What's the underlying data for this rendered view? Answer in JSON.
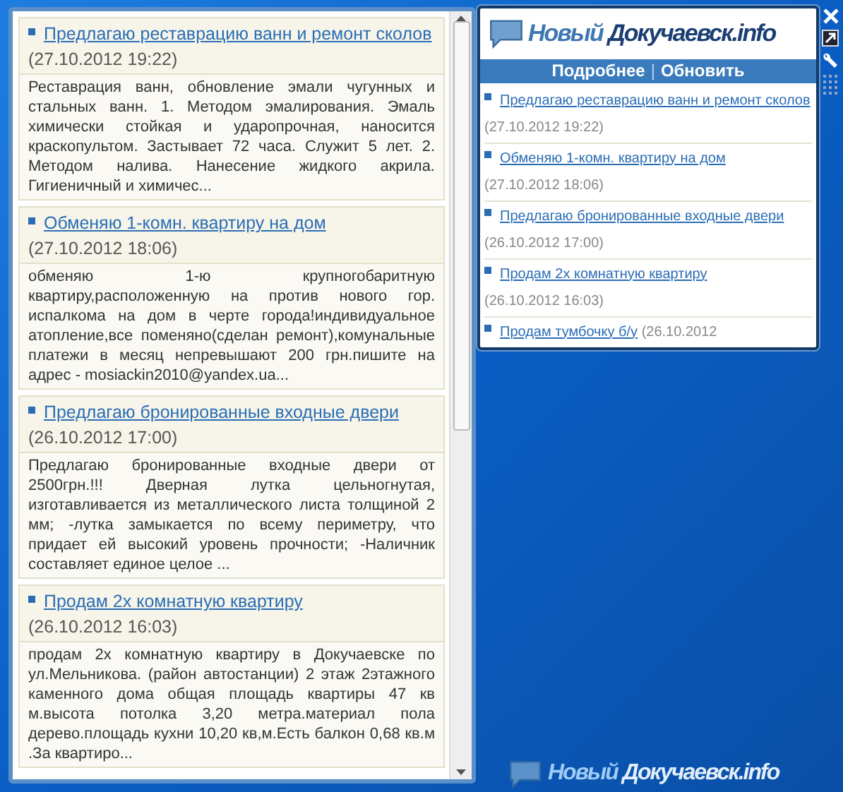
{
  "flyout": {
    "items": [
      {
        "title": "Предлагаю реставрацию ванн и ремонт сколов",
        "date": "(27.10.2012 19:22)",
        "body": "Реставрация ванн, обновление эмали чугунных и стальных ванн. 1. Методом эмалирования. Эмаль химически стойкая и ударопрочная, наносится краскопультом. Застывает 72 часа. Служит 5 лет. 2. Методом налива. Нанесение жидкого акрила. Гигиеничный и химичес..."
      },
      {
        "title": "Обменяю 1-комн. квартиру на дом",
        "date": "(27.10.2012 18:06)",
        "body": "обменяю 1-ю крупногобаритную квартиру,расположенную на против нового гор. испалкома на дом в черте города!индивидуальное атопление,все поменяно(сделан ремонт),комунальные платежи в месяц непревышают 200 грн.пишите на адрес - mosiackin2010@yandex.ua..."
      },
      {
        "title": "Предлагаю бронированные входные двери",
        "date": "(26.10.2012 17:00)",
        "body": "Предлагаю бронированные входные двери от 2500грн.!!! Дверная лутка цельногнутая, изготавливается из металлического листа толщиной 2 мм; -лутка замыкается по всему периметру, что придает ей высокий уровень прочности; -Наличник составляет единое целое ..."
      },
      {
        "title": "Продам 2х комнатную квартиру",
        "date": "(26.10.2012 16:03)",
        "body": "продам 2х комнатную квартиру в Докучаевске по ул.Мельникова. (район автостанции) 2 этаж 2этажного каменного дома общая площадь квартиры 47 кв м.высота потолка 3,20 метра.материал пола дерево.площадь кухни 10,20 кв,м.Есть балкон 0,68 кв.м .За квартиро..."
      }
    ]
  },
  "gadget": {
    "logo": {
      "part_1": "Новый",
      "part_2": "Докучаевск.info"
    },
    "links": [
      "Подробнее",
      "Обновить"
    ],
    "separator": "|",
    "items": [
      {
        "title": "Предлагаю реставрацию ванн и ремонт сколов",
        "date": "(27.10.2012 19:22)"
      },
      {
        "title": "Обменяю 1-комн. квартиру на дом",
        "date": "(27.10.2012 18:06)"
      },
      {
        "title": "Предлагаю бронированные входные двери",
        "date": "(26.10.2012 17:00)"
      },
      {
        "title": "Продам 2х комнатную квартиру",
        "date": "(26.10.2012 16:03)"
      },
      {
        "title": "Продам тумбочку б/у",
        "date": "(26.10.2012"
      }
    ]
  },
  "desktop_logo": {
    "part_1": "Новый",
    "part_2": "Докучаевск.info"
  }
}
